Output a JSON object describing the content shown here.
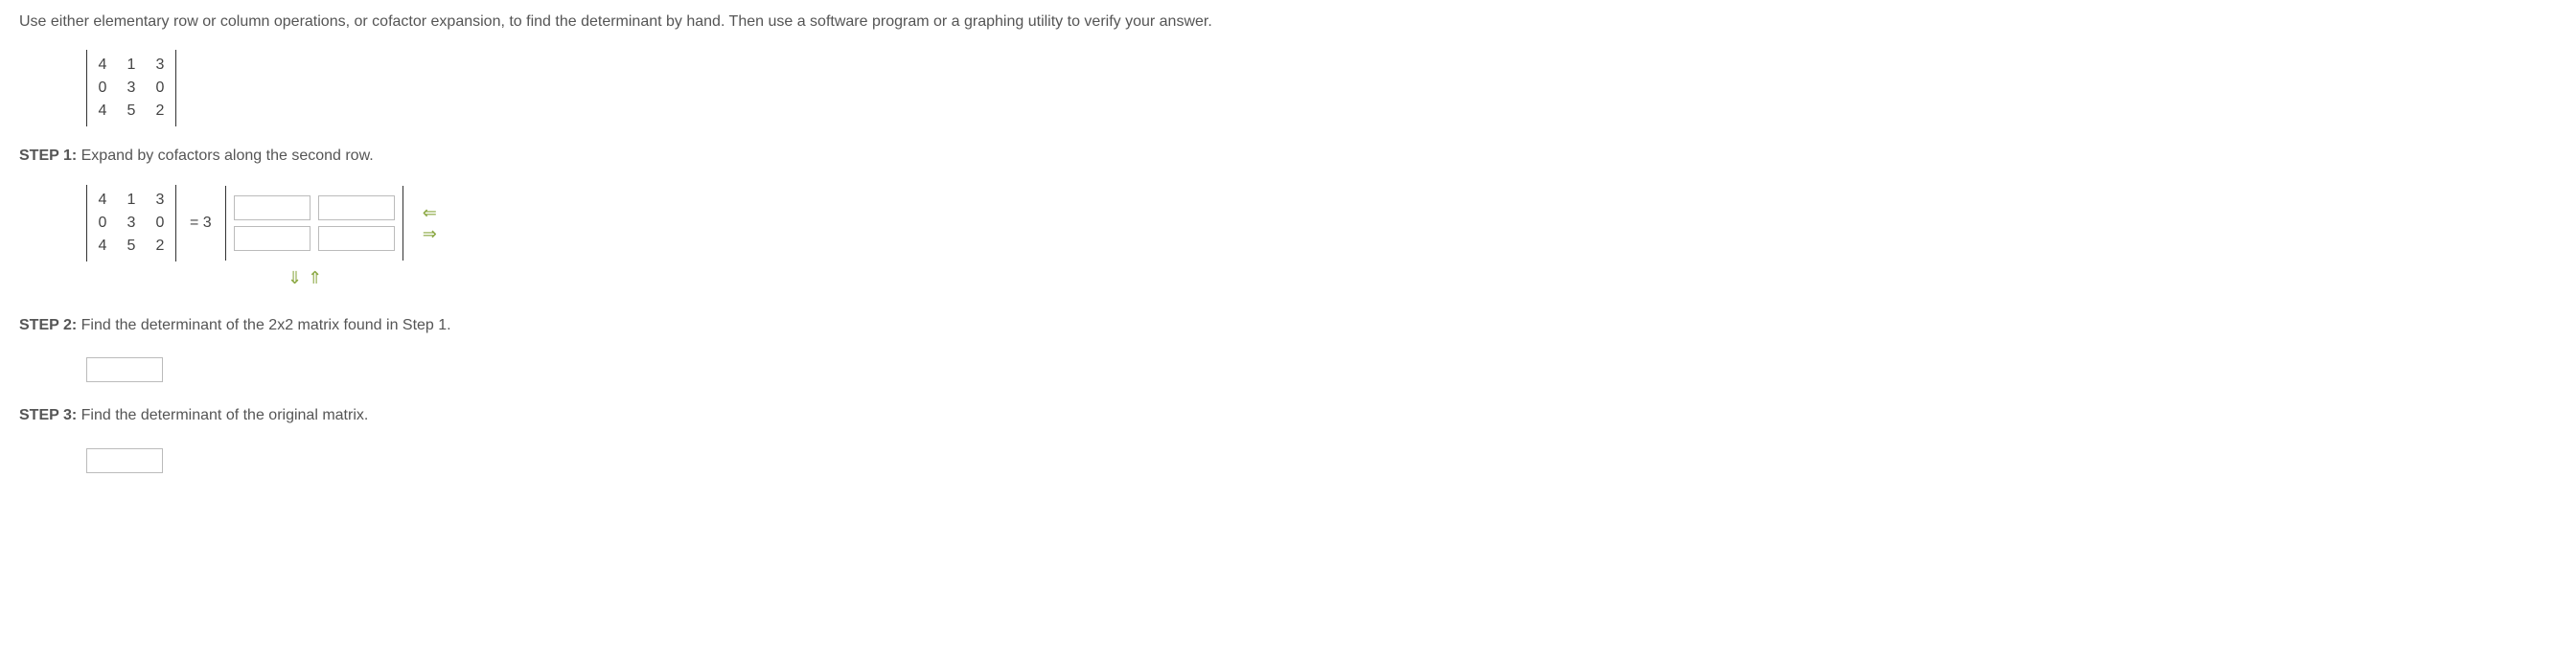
{
  "question": "Use either elementary row or column operations, or cofactor expansion, to find the determinant by hand. Then use a software program or a graphing utility to verify your answer.",
  "matrix": {
    "r1c1": "4",
    "r1c2": "1",
    "r1c3": "3",
    "r2c1": "0",
    "r2c2": "3",
    "r2c3": "0",
    "r3c1": "4",
    "r3c2": "5",
    "r3c3": "2"
  },
  "step1": {
    "label": "STEP 1:",
    "text": " Expand by cofactors along the second row.",
    "equals": "= 3"
  },
  "step2": {
    "label": "STEP 2:",
    "text": " Find the determinant of the 2x2 matrix found in Step 1."
  },
  "step3": {
    "label": "STEP 3:",
    "text": " Find the determinant of the original matrix."
  },
  "arrows": {
    "left": "⇐",
    "right": "⇒",
    "down": "⇓",
    "up": "⇑"
  }
}
